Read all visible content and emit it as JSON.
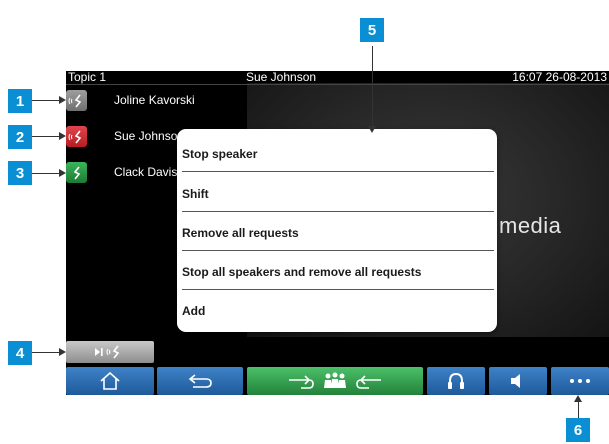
{
  "status_bar": {
    "topic": "Topic 1",
    "active_speaker": "Sue Johnson",
    "datetime": "16:07 26-08-2013"
  },
  "speakers": [
    {
      "name": "Joline Kavorski",
      "icon": "mic-request-icon",
      "color": "#8a8a8a"
    },
    {
      "name": "Sue Johnson",
      "icon": "mic-active-icon",
      "color": "#c8242b"
    },
    {
      "name": "Clack Davis",
      "icon": "mic-waiting-icon",
      "color": "#2c9b48"
    }
  ],
  "background_label": "media",
  "popup_menu": {
    "items": [
      {
        "label": "Stop speaker"
      },
      {
        "label": "Shift"
      },
      {
        "label": "Remove all requests"
      },
      {
        "label": "Stop all speakers and remove all requests"
      },
      {
        "label": "Add"
      }
    ]
  },
  "next_button": {
    "icon": "next-speaker-icon"
  },
  "navbar": {
    "buttons": [
      {
        "icon": "home-icon",
        "color": "#2a6db0"
      },
      {
        "icon": "back-icon",
        "color": "#2a6db0"
      },
      {
        "icon": "delegates-icon",
        "color": "#35a551"
      },
      {
        "icon": "headphones-icon",
        "color": "#2a6db0"
      },
      {
        "icon": "speaker-volume-icon",
        "color": "#2a6db0"
      },
      {
        "icon": "more-icon",
        "color": "#2a6db0"
      }
    ]
  },
  "callouts": [
    "1",
    "2",
    "3",
    "4",
    "5",
    "6"
  ],
  "callout_color": "#0a8fd4"
}
